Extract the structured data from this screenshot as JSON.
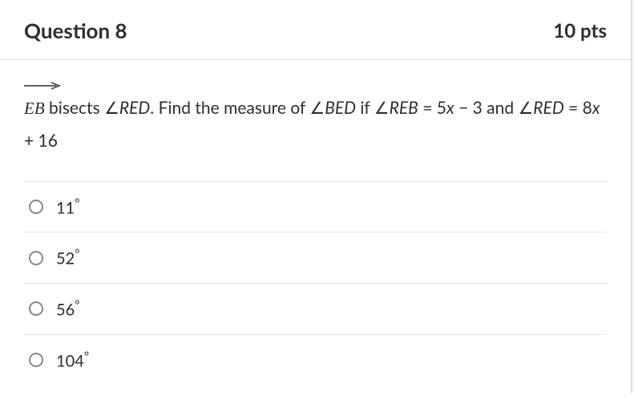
{
  "header": {
    "title": "Question 8",
    "points": "10 pts"
  },
  "prompt": {
    "ray_label": "EB",
    "t1": " bisects ",
    "ang1": "RED",
    "t2": ". Find the measure of ",
    "ang2": "BED",
    "t3": " if ",
    "ang3": "REB",
    "t4": " = 5x − 3 and ",
    "ang4": "RED",
    "t5": " = 8x + 16"
  },
  "options": [
    {
      "value": "11",
      "label": "11°"
    },
    {
      "value": "52",
      "label": "52°"
    },
    {
      "value": "56",
      "label": "56°"
    },
    {
      "value": "104",
      "label": "104°"
    }
  ]
}
